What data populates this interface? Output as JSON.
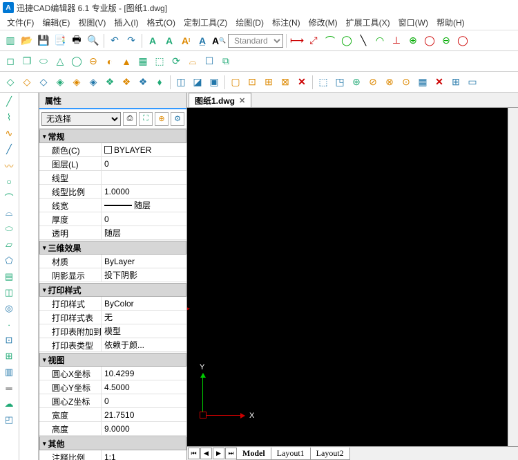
{
  "title": "迅捷CAD编辑器 6.1 专业版  - [图纸1.dwg]",
  "menu": [
    "文件(F)",
    "编辑(E)",
    "视图(V)",
    "插入(I)",
    "格式(O)",
    "定制工具(Z)",
    "绘图(D)",
    "标注(N)",
    "修改(M)",
    "扩展工具(X)",
    "窗口(W)",
    "帮助(H)"
  ],
  "style_select": "Standard",
  "prop_panel": {
    "title": "属性",
    "selector": "无选择"
  },
  "groups": [
    {
      "name": "常规",
      "rows": [
        {
          "l": "颜色(C)",
          "v": "BYLAYER",
          "color": true
        },
        {
          "l": "图层(L)",
          "v": "0"
        },
        {
          "l": "线型",
          "v": ""
        },
        {
          "l": "线型比例",
          "v": "1.0000"
        },
        {
          "l": "线宽",
          "v": "随层",
          "line": true
        },
        {
          "l": "厚度",
          "v": "0"
        },
        {
          "l": "透明",
          "v": "随层"
        }
      ]
    },
    {
      "name": "三维效果",
      "rows": [
        {
          "l": "材质",
          "v": "ByLayer"
        },
        {
          "l": "阴影显示",
          "v": "投下阴影"
        }
      ]
    },
    {
      "name": "打印样式",
      "rows": [
        {
          "l": "打印样式",
          "v": "ByColor"
        },
        {
          "l": "打印样式表",
          "v": "无"
        },
        {
          "l": "打印表附加到",
          "v": "模型"
        },
        {
          "l": "打印表类型",
          "v": "依赖于颜..."
        }
      ]
    },
    {
      "name": "视图",
      "rows": [
        {
          "l": "圆心X坐标",
          "v": "10.4299"
        },
        {
          "l": "圆心Y坐标",
          "v": "4.5000"
        },
        {
          "l": "圆心Z坐标",
          "v": "0"
        },
        {
          "l": "宽度",
          "v": "21.7510"
        },
        {
          "l": "高度",
          "v": "9.0000"
        }
      ]
    },
    {
      "name": "其他",
      "rows": [
        {
          "l": "注释比例",
          "v": "1:1"
        }
      ]
    }
  ],
  "doc_tab": "图纸1.dwg",
  "axis": {
    "x": "X",
    "y": "Y"
  },
  "layouts": {
    "model": "Model",
    "l1": "Layout1",
    "l2": "Layout2"
  }
}
